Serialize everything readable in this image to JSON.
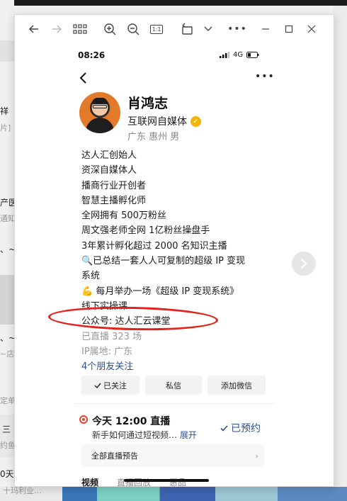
{
  "background": {
    "fragments": [
      "祥",
      "片]",
      "产医",
      "通知",
      "、~ 君",
      "、~",
      "~店",
      "定单",
      "三",
      "约鱼",
      "0天",
      "十玛利业..."
    ]
  },
  "window": {
    "toolbar": {
      "back": "arrow-left-icon",
      "forward": "arrow-right-icon",
      "grid": "grid-icon",
      "zoom_in": "zoom-in-icon",
      "zoom_out": "zoom-out-icon",
      "actual_size_label": "1:1",
      "rotate": "rotate-icon",
      "dropdown": "chevron-down-icon",
      "more": "more-icon",
      "minimize": "minimize-icon",
      "maximize": "maximize-icon",
      "close": "close-icon"
    }
  },
  "phone": {
    "status": {
      "time": "08:26",
      "network": "4G"
    },
    "profile": {
      "name": "肖鸿志",
      "title": "互联网自媒体",
      "location": "广东 惠州 男"
    },
    "bio": [
      "达人汇创始人",
      "资深自媒体人",
      "播商行业开创者",
      "智慧主播孵化师",
      "全网拥有 500万粉丝",
      "周文强老师全网 1亿粉丝操盘手",
      "3年累计孵化超过 2000 名知识主播",
      "🔍已总结一套人人可复制的超级 IP 变现",
      "系统",
      "💪 每月举办一场《超级 IP 变现系统》",
      "线下实操课",
      "公众号: 达人汇云课堂"
    ],
    "stats": {
      "lives": "已直播 323 场",
      "ip": "IP属地: 广东",
      "friends": "4个朋友关注"
    },
    "buttons": {
      "followed": "已关注",
      "message": "私信",
      "add_wechat": "添加微信"
    },
    "live": {
      "title": "今天 12:00 直播",
      "desc": "新手如何通过短视频…",
      "expand": "展开",
      "reserved": "已预约",
      "all": "全部直播预告"
    },
    "tabs": [
      "视频",
      "直播回放",
      "惠品"
    ]
  },
  "colors": {
    "accent_blue": "#2d4e8f",
    "live_red": "#e5432e",
    "highlight_red": "#e2221b",
    "verify_gold": "#f4b400"
  }
}
